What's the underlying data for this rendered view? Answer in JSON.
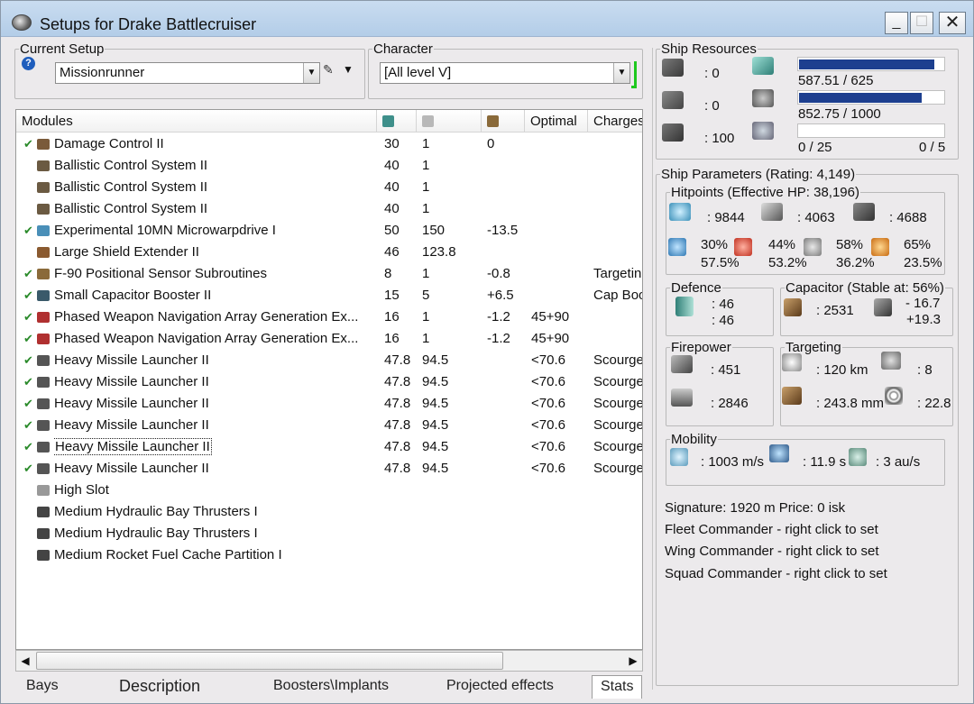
{
  "window": {
    "title": "Setups for Drake Battlecruiser",
    "min": "_",
    "max": "☐",
    "close": "✕"
  },
  "setup": {
    "legend": "Current Setup",
    "value": "Missionrunner"
  },
  "character": {
    "legend": "Character",
    "value": "[All level V]"
  },
  "modules": {
    "headers": {
      "name": "Modules",
      "optimal": "Optimal",
      "charges": "Charges"
    },
    "rows": [
      {
        "check": true,
        "name": "Damage Control II",
        "cpu": "30",
        "pg": "1",
        "cap": "0",
        "optimal": "",
        "charge": "",
        "icon_color": "#7a5a3a"
      },
      {
        "check": false,
        "name": "Ballistic Control System II",
        "cpu": "40",
        "pg": "1",
        "cap": "",
        "optimal": "",
        "charge": "",
        "icon_color": "#6b5a42"
      },
      {
        "check": false,
        "name": "Ballistic Control System II",
        "cpu": "40",
        "pg": "1",
        "cap": "",
        "optimal": "",
        "charge": "",
        "icon_color": "#6b5a42"
      },
      {
        "check": false,
        "name": "Ballistic Control System II",
        "cpu": "40",
        "pg": "1",
        "cap": "",
        "optimal": "",
        "charge": "",
        "icon_color": "#6b5a42"
      },
      {
        "check": true,
        "name": "Experimental 10MN Microwarpdrive I",
        "cpu": "50",
        "pg": "150",
        "cap": "-13.5",
        "optimal": "",
        "charge": "",
        "icon_color": "#4a8fb8"
      },
      {
        "check": false,
        "name": "Large Shield Extender II",
        "cpu": "46",
        "pg": "123.8",
        "cap": "",
        "optimal": "",
        "charge": "",
        "icon_color": "#8a5a30"
      },
      {
        "check": true,
        "name": "F-90 Positional Sensor Subroutines",
        "cpu": "8",
        "pg": "1",
        "cap": "-0.8",
        "optimal": "",
        "charge": "Targeting",
        "icon_color": "#8a6a3a"
      },
      {
        "check": true,
        "name": "Small Capacitor Booster II",
        "cpu": "15",
        "pg": "5",
        "cap": "+6.5",
        "optimal": "",
        "charge": "Cap Booster",
        "icon_color": "#3a5a6a"
      },
      {
        "check": true,
        "name": "Phased Weapon Navigation Array Generation Ex...",
        "cpu": "16",
        "pg": "1",
        "cap": "-1.2",
        "optimal": "45+90",
        "charge": "",
        "icon_color": "#b03030"
      },
      {
        "check": true,
        "name": "Phased Weapon Navigation Array Generation Ex...",
        "cpu": "16",
        "pg": "1",
        "cap": "-1.2",
        "optimal": "45+90",
        "charge": "",
        "icon_color": "#b03030"
      },
      {
        "check": true,
        "name": "Heavy Missile Launcher II",
        "cpu": "47.8",
        "pg": "94.5",
        "cap": "",
        "optimal": "<70.6",
        "charge": "Scourge",
        "icon_color": "#555555"
      },
      {
        "check": true,
        "name": "Heavy Missile Launcher II",
        "cpu": "47.8",
        "pg": "94.5",
        "cap": "",
        "optimal": "<70.6",
        "charge": "Scourge",
        "icon_color": "#555555"
      },
      {
        "check": true,
        "name": "Heavy Missile Launcher II",
        "cpu": "47.8",
        "pg": "94.5",
        "cap": "",
        "optimal": "<70.6",
        "charge": "Scourge",
        "icon_color": "#555555"
      },
      {
        "check": true,
        "name": "Heavy Missile Launcher II",
        "cpu": "47.8",
        "pg": "94.5",
        "cap": "",
        "optimal": "<70.6",
        "charge": "Scourge",
        "icon_color": "#555555"
      },
      {
        "check": true,
        "name": "Heavy Missile Launcher II",
        "cpu": "47.8",
        "pg": "94.5",
        "cap": "",
        "optimal": "<70.6",
        "charge": "Scourge",
        "icon_color": "#555555",
        "selected": true
      },
      {
        "check": true,
        "name": "Heavy Missile Launcher II",
        "cpu": "47.8",
        "pg": "94.5",
        "cap": "",
        "optimal": "<70.6",
        "charge": "Scourge",
        "icon_color": "#555555"
      },
      {
        "check": false,
        "name": "High Slot",
        "cpu": "",
        "pg": "",
        "cap": "",
        "optimal": "",
        "charge": "",
        "icon_color": "#999999"
      },
      {
        "check": false,
        "name": "Medium Hydraulic Bay Thrusters I",
        "cpu": "",
        "pg": "",
        "cap": "",
        "optimal": "",
        "charge": "",
        "icon_color": "#444444"
      },
      {
        "check": false,
        "name": "Medium Hydraulic Bay Thrusters I",
        "cpu": "",
        "pg": "",
        "cap": "",
        "optimal": "",
        "charge": "",
        "icon_color": "#444444"
      },
      {
        "check": false,
        "name": "Medium Rocket Fuel Cache Partition I",
        "cpu": "",
        "pg": "",
        "cap": "",
        "optimal": "",
        "charge": "",
        "icon_color": "#444444"
      }
    ]
  },
  "tabs": [
    "Bays",
    "Description",
    "Boosters\\Implants",
    "Projected effects",
    "Stats"
  ],
  "resources": {
    "legend": "Ship Resources",
    "turrets": ": 0",
    "launchers": ": 0",
    "calibration": ": 100",
    "cpu": "587.51 / 625",
    "cpu_fraction": 0.94,
    "powergrid": "852.75 / 1000",
    "powergrid_fraction": 0.853,
    "drone_bw": "0 / 25",
    "drones": "0 / 5",
    "drone_bw_fraction": 0
  },
  "parameters": {
    "legend": "Ship Parameters (Rating: 4,149)"
  },
  "hitpoints": {
    "legend": "Hitpoints (Effective HP: 38,196)",
    "shield": ": 9844",
    "armor": ": 4063",
    "structure": ": 4688",
    "em_shield": "30%",
    "em_armor": "57.5%",
    "thermal_shield": "44%",
    "thermal_armor": "53.2%",
    "kinetic_shield": "58%",
    "kinetic_armor": "36.2%",
    "explosive_shield": "65%",
    "explosive_armor": "23.5%"
  },
  "defence": {
    "legend": "Defence",
    "val1": ": 46",
    "val2": ": 46"
  },
  "capacitor": {
    "legend": "Capacitor (Stable at: 56%)",
    "capacity": ": 2531",
    "delta1": "- 16.7",
    "delta2": "+19.3"
  },
  "firepower": {
    "legend": "Firepower",
    "dps": ": 451",
    "volley": ": 2846"
  },
  "targeting": {
    "legend": "Targeting",
    "range": ": 120 km",
    "targets": ": 8",
    "scan_res": ": 243.8 mm",
    "sensor": ": 22.8"
  },
  "mobility": {
    "legend": "Mobility",
    "velocity": ": 1003 m/s",
    "align": ": 11.9 s",
    "warp": ": 3 au/s"
  },
  "info": {
    "signature": "Signature: 1920 m  Price: 0 isk",
    "fleet": "Fleet Commander - right click to set",
    "wing": "Wing Commander - right click to set",
    "squad": "Squad Commander - right click to set"
  }
}
